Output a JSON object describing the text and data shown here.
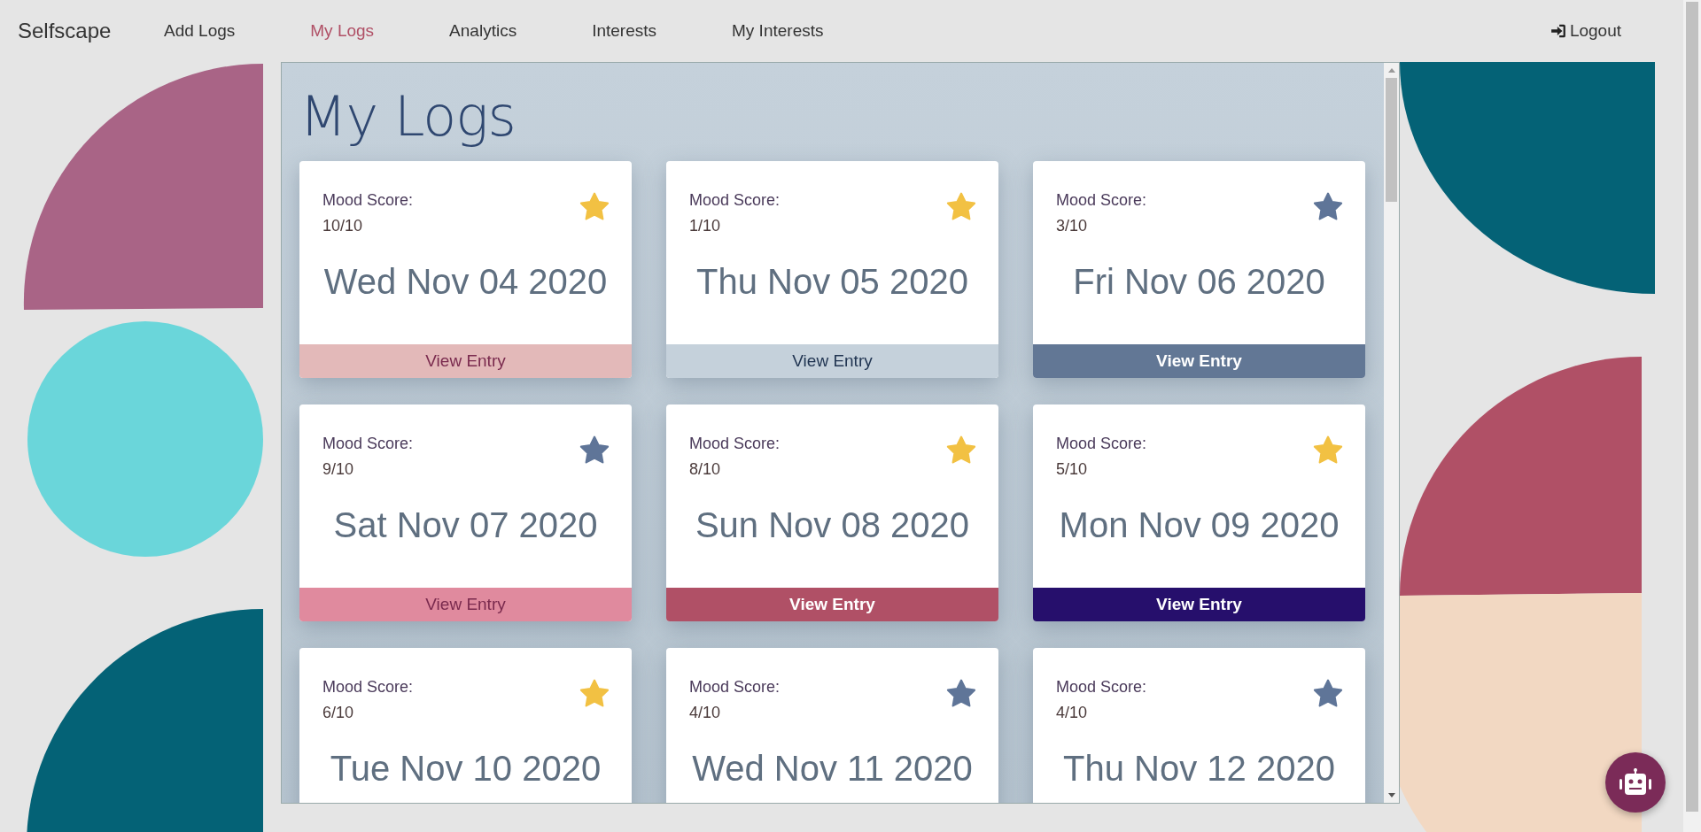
{
  "nav": {
    "brand": "Selfscape",
    "links": [
      {
        "label": "Add Logs",
        "selected": false
      },
      {
        "label": "My Logs",
        "selected": true
      },
      {
        "label": "Analytics",
        "selected": false
      },
      {
        "label": "Interests",
        "selected": false
      },
      {
        "label": "My Interests",
        "selected": false
      }
    ],
    "logout": "Logout"
  },
  "page_title": "My Logs",
  "cards": [
    {
      "mood_label": "Mood Score:",
      "score": "10/10",
      "date": "Wed Nov 04 2020",
      "starred": true,
      "button": "View Entry",
      "color": "#e3b9b9"
    },
    {
      "mood_label": "Mood Score:",
      "score": "1/10",
      "date": "Thu Nov 05 2020",
      "starred": true,
      "button": "View Entry",
      "color": "#c5d1db"
    },
    {
      "mood_label": "Mood Score:",
      "score": "3/10",
      "date": "Fri Nov 06 2020",
      "starred": false,
      "button": "View Entry",
      "color": "#627795"
    },
    {
      "mood_label": "Mood Score:",
      "score": "9/10",
      "date": "Sat Nov 07 2020",
      "starred": false,
      "button": "View Entry",
      "color": "#e08a9e"
    },
    {
      "mood_label": "Mood Score:",
      "score": "8/10",
      "date": "Sun Nov 08 2020",
      "starred": true,
      "button": "View Entry",
      "color": "#b05066"
    },
    {
      "mood_label": "Mood Score:",
      "score": "5/10",
      "date": "Mon Nov 09 2020",
      "starred": true,
      "button": "View Entry",
      "color": "#260f6c"
    },
    {
      "mood_label": "Mood Score:",
      "score": "6/10",
      "date": "Tue Nov 10 2020",
      "starred": true
    },
    {
      "mood_label": "Mood Score:",
      "score": "4/10",
      "date": "Wed Nov 11 2020",
      "starred": false
    },
    {
      "mood_label": "Mood Score:",
      "score": "4/10",
      "date": "Thu Nov 12 2020",
      "starred": false
    }
  ]
}
